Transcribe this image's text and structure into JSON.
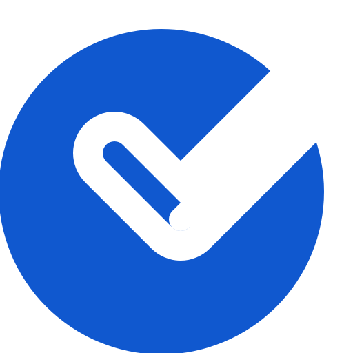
{
  "icon": {
    "name": "check-circle-icon",
    "colors": {
      "primary": "#1058CF",
      "background": "#FFFFFF"
    }
  }
}
